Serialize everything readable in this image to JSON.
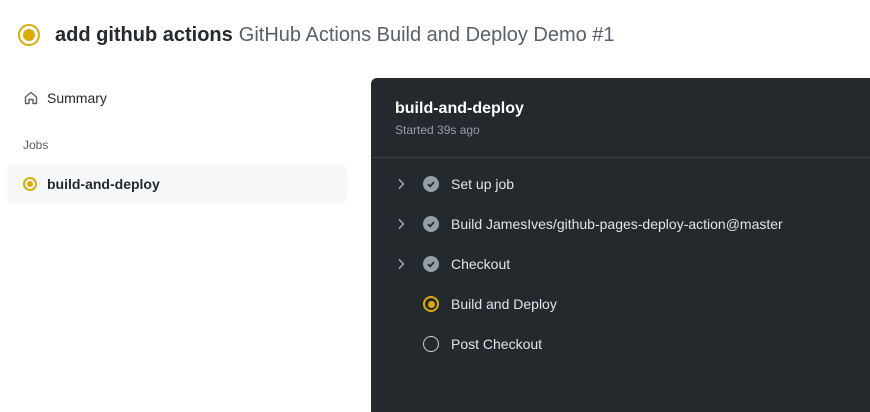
{
  "header": {
    "title": "add github actions",
    "subtitle": "GitHub Actions Build and Deploy Demo #1",
    "status_icon": "in-progress-icon"
  },
  "sidebar": {
    "summary_label": "Summary",
    "jobs_heading": "Jobs",
    "jobs": [
      {
        "label": "build-and-deploy",
        "status": "in_progress"
      }
    ]
  },
  "job": {
    "title": "build-and-deploy",
    "started": "Started 39s ago",
    "steps": [
      {
        "label": "Set up job",
        "status": "success",
        "expandable": true
      },
      {
        "label": "Build JamesIves/github-pages-deploy-action@master",
        "status": "success",
        "expandable": true
      },
      {
        "label": "Checkout",
        "status": "success",
        "expandable": true
      },
      {
        "label": "Build and Deploy",
        "status": "in_progress",
        "expandable": false
      },
      {
        "label": "Post Checkout",
        "status": "pending",
        "expandable": false
      }
    ]
  },
  "colors": {
    "in_progress": "#dbab0a",
    "panel_bg": "#24292e",
    "success_icon": "#959da5"
  }
}
